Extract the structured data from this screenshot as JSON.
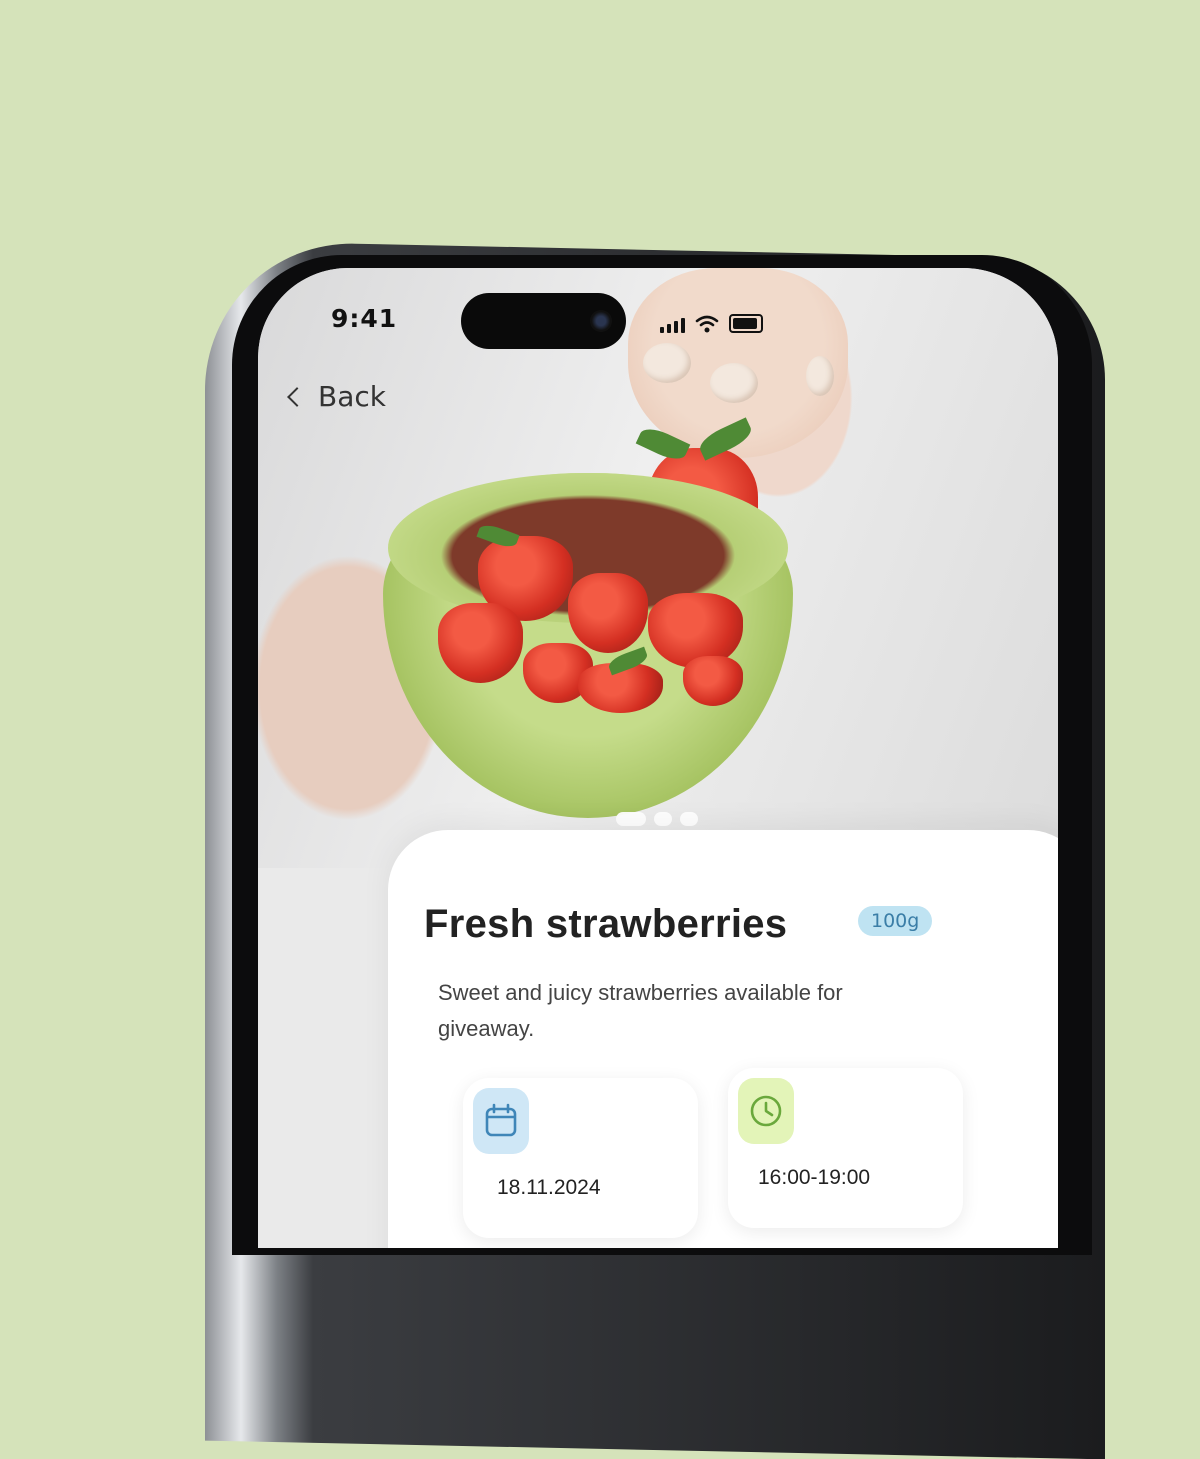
{
  "status_bar": {
    "time": "9:41"
  },
  "nav": {
    "back_label": "Back"
  },
  "gallery": {
    "page_count": 3,
    "active_index": 0
  },
  "product": {
    "title": "Fresh strawberries",
    "quantity_badge": "100g",
    "description": "Sweet and juicy strawberries available for giveaway."
  },
  "details": {
    "date": {
      "icon": "calendar-icon",
      "value": "18.11.2024"
    },
    "time": {
      "icon": "clock-icon",
      "value": "16:00-19:00"
    }
  },
  "colors": {
    "background": "#d5e3ba",
    "badge_bg": "#bfe3f2",
    "badge_text": "#3b7ea7",
    "date_icon_bg": "#cfe7f6",
    "time_icon_bg": "#e3f4b8"
  }
}
